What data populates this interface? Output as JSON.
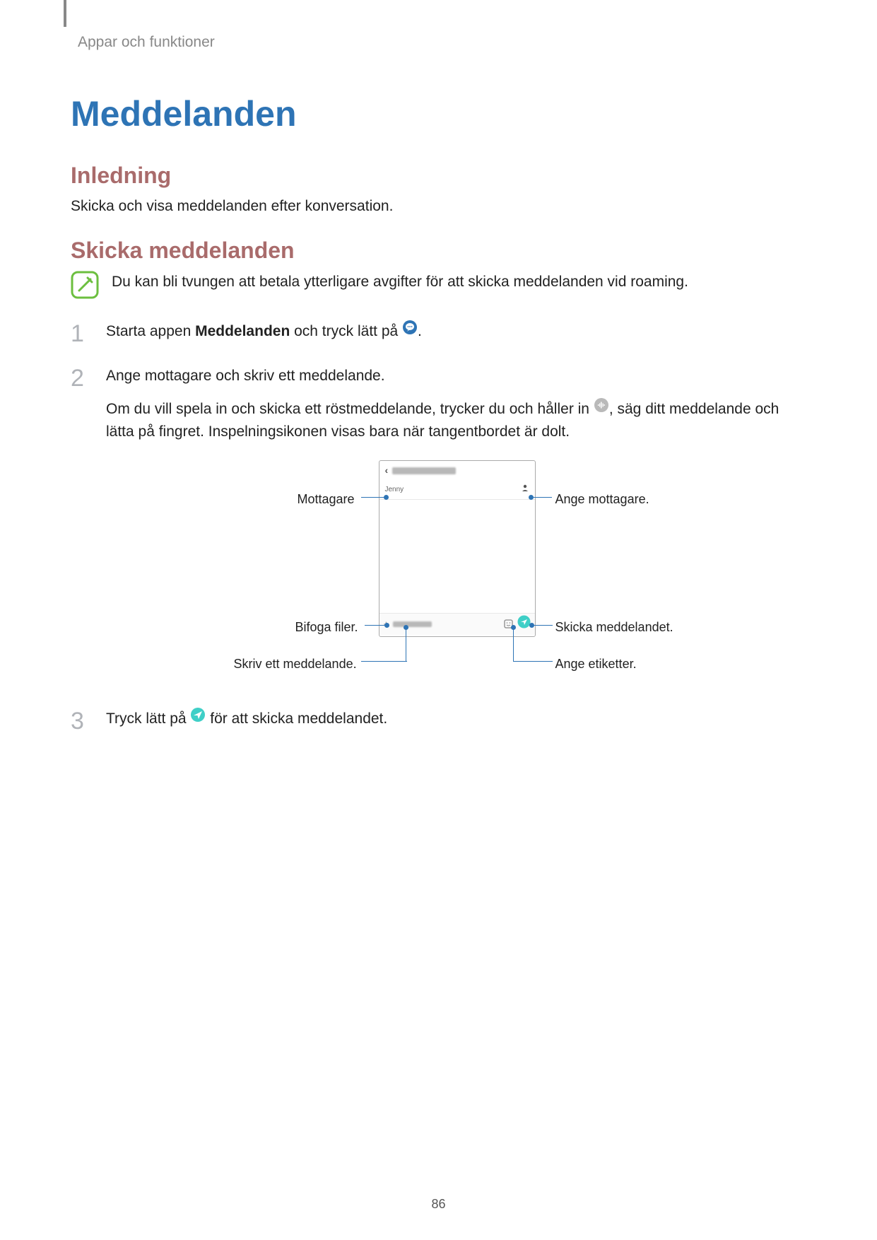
{
  "header": {
    "breadcrumb": "Appar och funktioner"
  },
  "title": "Meddelanden",
  "section_intro": {
    "heading": "Inledning",
    "text": "Skicka och visa meddelanden efter konversation."
  },
  "section_send": {
    "heading": "Skicka meddelanden",
    "note": "Du kan bli tvungen att betala ytterligare avgifter för att skicka meddelanden vid roaming.",
    "step1_pre": "Starta appen ",
    "step1_bold": "Meddelanden",
    "step1_post": " och tryck lätt på ",
    "step1_end": ".",
    "step2_line1": "Ange mottagare och skriv ett meddelande.",
    "step2_line2_pre": "Om du vill spela in och skicka ett röstmeddelande, trycker du och håller in ",
    "step2_line2_post": ", säg ditt meddelande och lätta på fingret. Inspelningsikonen visas bara när tangentbordet är dolt.",
    "step3_pre": "Tryck lätt på ",
    "step3_post": " för att skicka meddelandet."
  },
  "diagram": {
    "recipient_name": "Jenny",
    "callouts": {
      "recipient": "Mottagare",
      "add_recipient": "Ange mottagare.",
      "attach": "Bifoga filer.",
      "send": "Skicka meddelandet.",
      "write": "Skriv ett meddelande.",
      "labels": "Ange etiketter."
    }
  },
  "page_number": "86",
  "icons": {
    "compose": "compose-speech-bubble",
    "voice": "voice-waveform",
    "send": "send-paper-plane",
    "note": "pencil-note",
    "back": "chevron-left",
    "contact": "person",
    "plus": "plus",
    "sticker": "sticker"
  }
}
